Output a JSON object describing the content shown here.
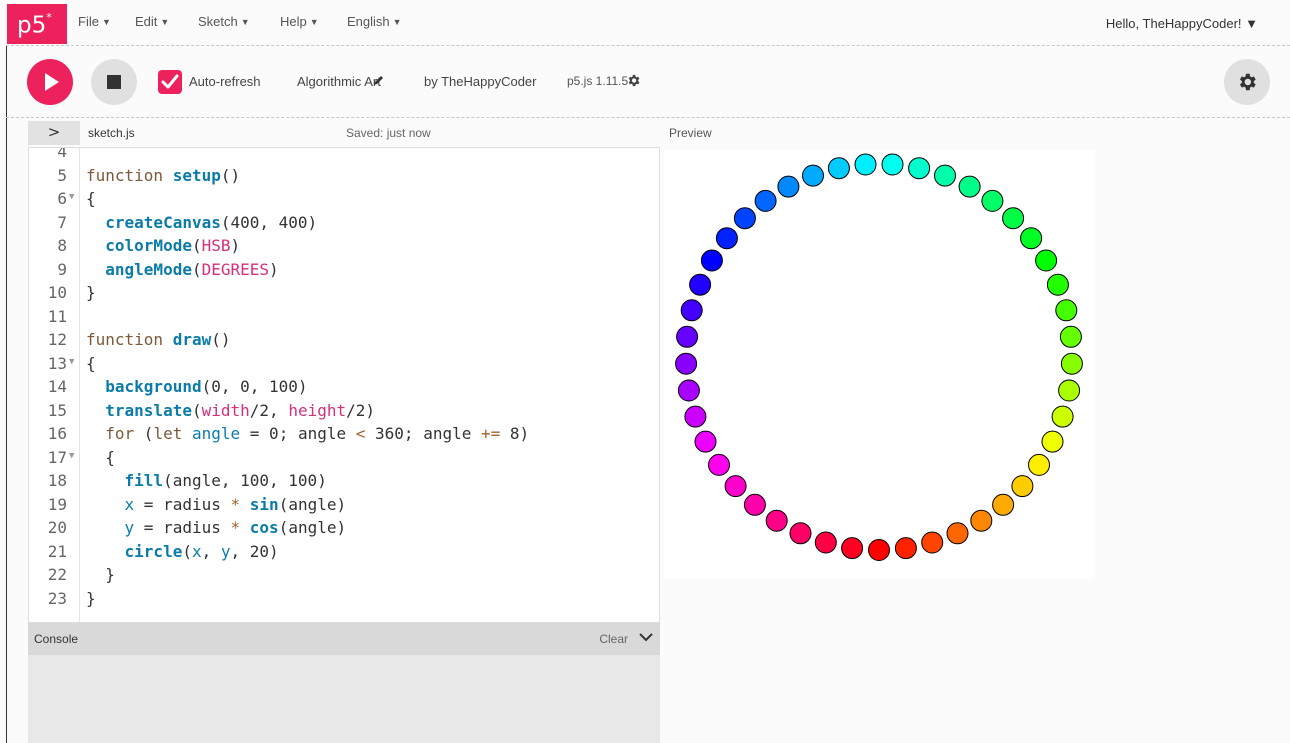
{
  "app": {
    "logo_text": "p5",
    "logo_star": "*"
  },
  "menu": {
    "items": [
      {
        "label": "File",
        "caret": "▼"
      },
      {
        "label": "Edit",
        "caret": "▼"
      },
      {
        "label": "Sketch",
        "caret": "▼"
      },
      {
        "label": "Help",
        "caret": "▼"
      },
      {
        "label": "English",
        "caret": "▼"
      }
    ],
    "user_greeting": "Hello, TheHappyCoder! ▼"
  },
  "toolbar": {
    "auto_refresh_label": "Auto-refresh",
    "auto_refresh_checked": true,
    "project_name": "Algorithmic Art",
    "by_owner": "by TheHappyCoder",
    "version": "p5.js 1.11.5"
  },
  "editor": {
    "collapse_glyph": ">",
    "file_name": "sketch.js",
    "save_status": "Saved: just now",
    "lines": [
      {
        "n": "4",
        "fold": false
      },
      {
        "n": "5",
        "fold": false
      },
      {
        "n": "6",
        "fold": true
      },
      {
        "n": "7",
        "fold": false
      },
      {
        "n": "8",
        "fold": false
      },
      {
        "n": "9",
        "fold": false
      },
      {
        "n": "10",
        "fold": false
      },
      {
        "n": "11",
        "fold": false
      },
      {
        "n": "12",
        "fold": false
      },
      {
        "n": "13",
        "fold": true
      },
      {
        "n": "14",
        "fold": false
      },
      {
        "n": "15",
        "fold": false
      },
      {
        "n": "16",
        "fold": false
      },
      {
        "n": "17",
        "fold": true
      },
      {
        "n": "18",
        "fold": false
      },
      {
        "n": "19",
        "fold": false
      },
      {
        "n": "20",
        "fold": false
      },
      {
        "n": "21",
        "fold": false
      },
      {
        "n": "22",
        "fold": false
      },
      {
        "n": "23",
        "fold": false
      }
    ]
  },
  "console": {
    "title": "Console",
    "clear_label": "Clear"
  },
  "preview": {
    "label": "Preview",
    "circle_count": 45,
    "angle_step_degrees": 8
  }
}
